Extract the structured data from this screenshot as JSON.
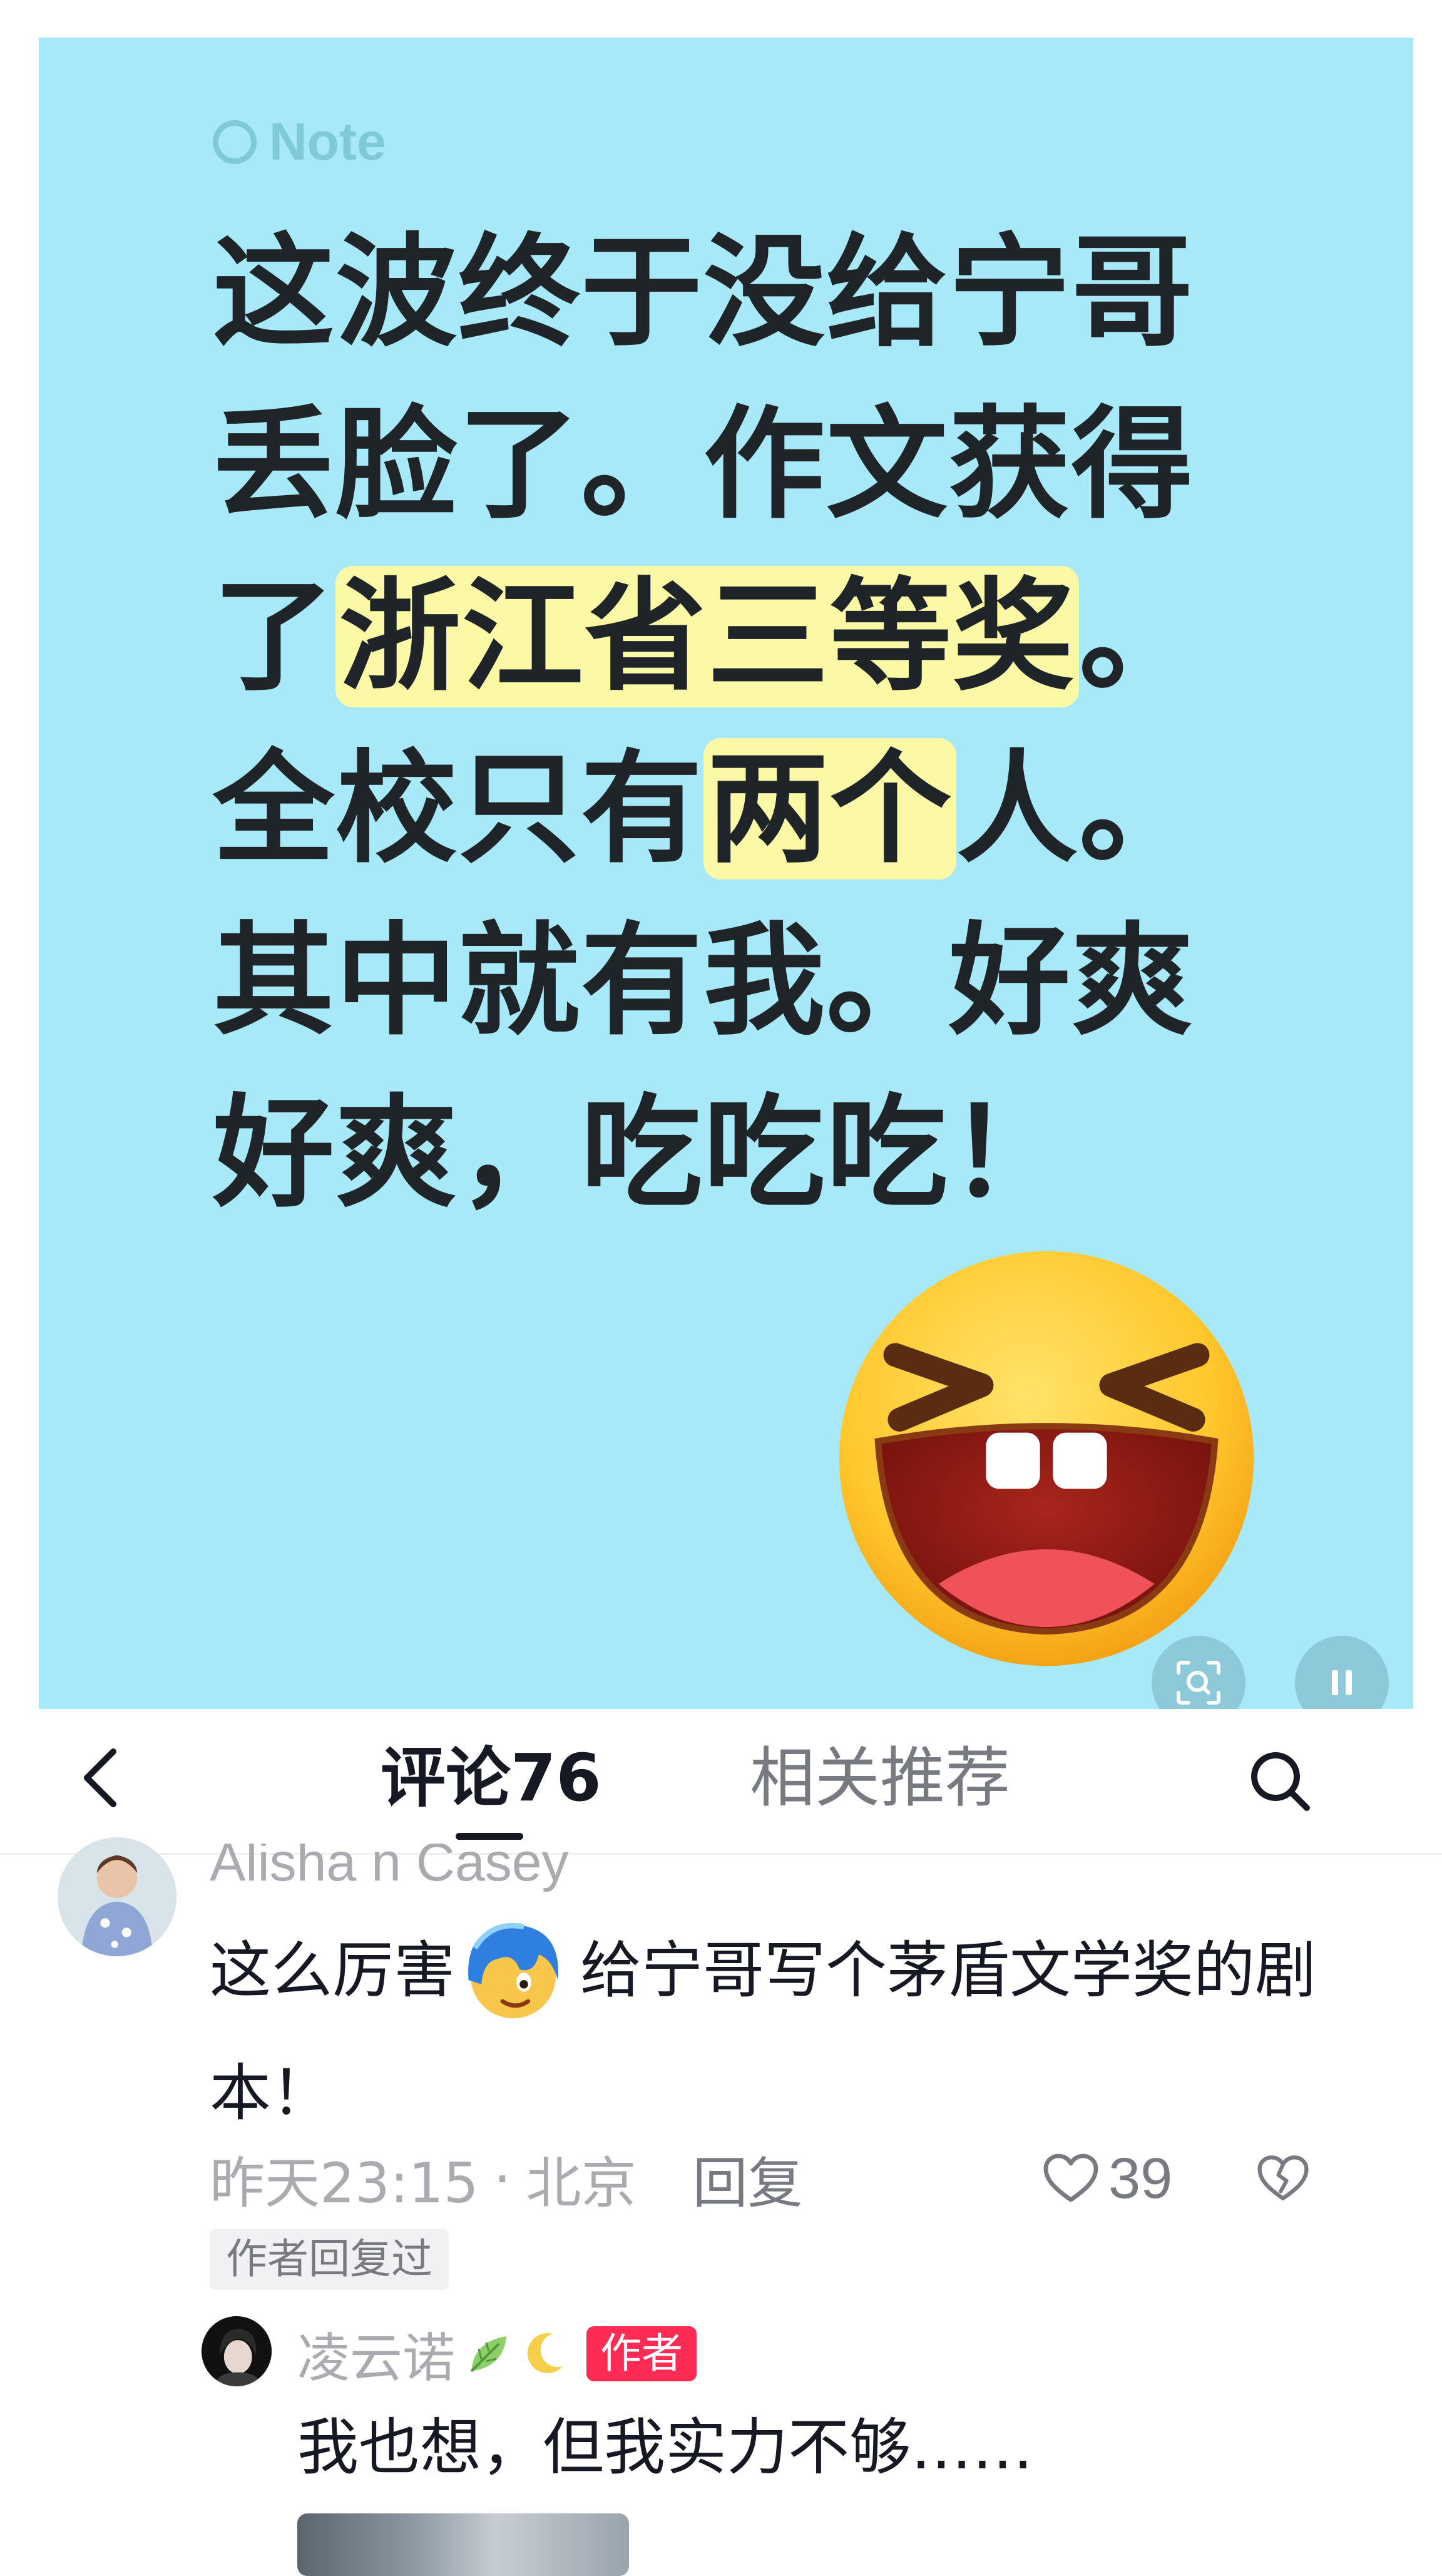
{
  "note": {
    "badge": "Note",
    "lines": [
      [
        "这波终于没给宁哥"
      ],
      [
        "丢脸了。作文获得"
      ],
      [
        "了",
        "浙江省三等奖",
        "。"
      ],
      [
        "全校只有",
        "两个",
        "人。"
      ],
      [
        "其中就有我。好爽"
      ],
      [
        "好爽，吃吃吃！"
      ]
    ],
    "highlight_color": "#fbf8a6",
    "background_color": "#a7e9f8",
    "sticker": "laughing-face-emoji",
    "controls": [
      "image-search-icon",
      "pause-icon"
    ]
  },
  "header": {
    "comments_label": "评论76",
    "related_label": "相关推荐",
    "back_icon": "chevron-left-icon",
    "search_icon": "search-icon"
  },
  "comment": {
    "author": "Alisha n Casey",
    "text_before_emoji": "这么厉害",
    "inline_emoji": "blue-hair-face-emoji",
    "text_after_emoji": "给宁哥写个茅盾文学奖的剧本！",
    "time": "昨天23:15",
    "separator": "·",
    "location": "北京",
    "reply_label": "回复",
    "likes": "39",
    "author_replied": "作者回复过"
  },
  "reply": {
    "author": "凌云诺",
    "author_decorations": [
      "leaf-emoji",
      "crescent-moon-emoji"
    ],
    "author_tag": "作者",
    "text": "我也想，但我实力不够……"
  }
}
